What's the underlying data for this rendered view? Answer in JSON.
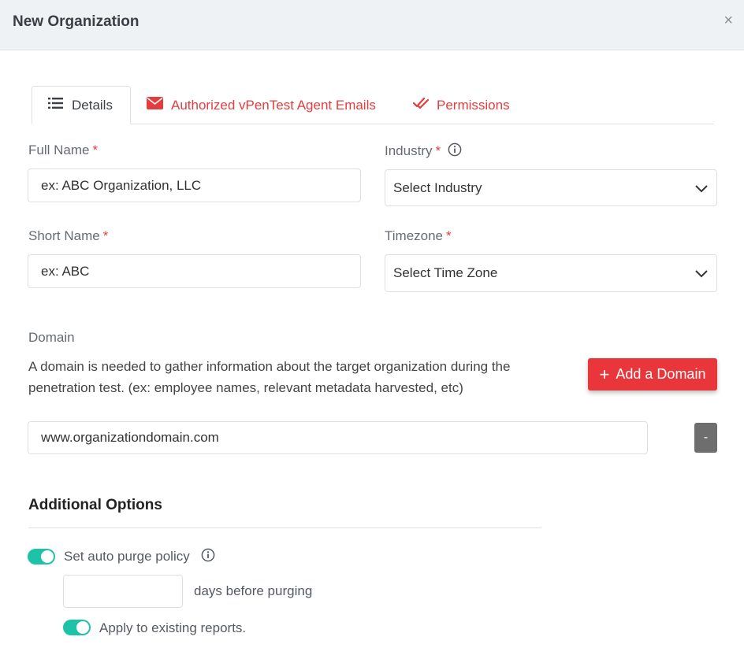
{
  "header": {
    "title": "New Organization",
    "close": "×"
  },
  "tabs": [
    {
      "label": "Details",
      "icon": "list-icon"
    },
    {
      "label": "Authorized vPenTest Agent Emails",
      "icon": "envelope-icon"
    },
    {
      "label": "Permissions",
      "icon": "double-check-icon"
    }
  ],
  "form": {
    "full_name": {
      "label": "Full Name",
      "required": "*",
      "placeholder": "ex: ABC Organization, LLC"
    },
    "industry": {
      "label": "Industry",
      "required": "*",
      "value": "Select Industry"
    },
    "short_name": {
      "label": "Short Name",
      "required": "*",
      "placeholder": "ex: ABC"
    },
    "timezone": {
      "label": "Timezone",
      "required": "*",
      "value": "Select Time Zone"
    }
  },
  "domain": {
    "label": "Domain",
    "description": "A domain is needed to gather information about the target organization during the penetration test. (ex: employee names, relevant metadata harvested, etc)",
    "add_button": "Add a Domain",
    "add_icon": "+",
    "input_value": "www.organizationdomain.com",
    "remove_button": "-"
  },
  "additional_options": {
    "title": "Additional Options",
    "auto_purge": {
      "label": "Set auto purge policy",
      "enabled": true
    },
    "days": {
      "value": "",
      "suffix": "days before purging"
    },
    "apply_existing": {
      "label": "Apply to existing reports.",
      "enabled": true
    }
  },
  "colors": {
    "accent": "#e53d3d",
    "toggle": "#1dc3a6",
    "button_red": "#e8363b"
  }
}
